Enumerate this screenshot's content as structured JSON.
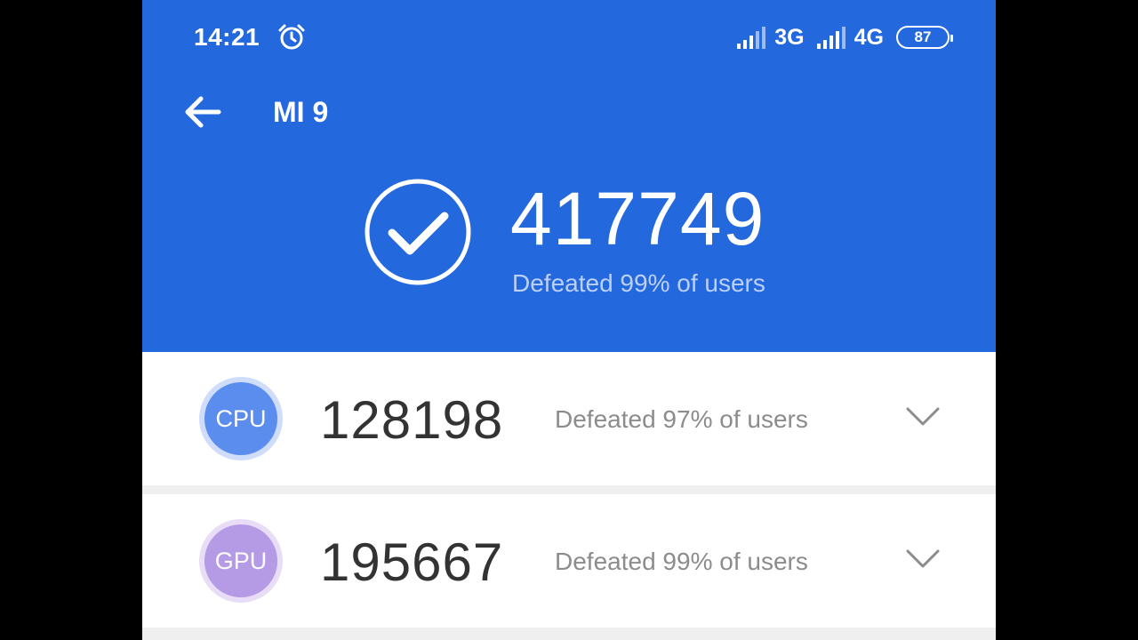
{
  "colors": {
    "header_blue": "#2468de",
    "cpu_badge": "#5b8def",
    "cpu_ring": "#cfdcfa",
    "gpu_badge": "#b59ae6",
    "gpu_ring": "#e8dcf7"
  },
  "status_bar": {
    "time": "14:21",
    "alarm_icon": "alarm-clock-icon",
    "network_1": "3G",
    "network_2": "4G",
    "battery_level": "87"
  },
  "header": {
    "title": "MI 9",
    "back_icon": "arrow-left-icon"
  },
  "total": {
    "score": "417749",
    "defeated_text": "Defeated 99% of users"
  },
  "cards": [
    {
      "label": "CPU",
      "score": "128198",
      "defeated_text": "Defeated 97% of users"
    },
    {
      "label": "GPU",
      "score": "195667",
      "defeated_text": "Defeated 99% of users"
    }
  ]
}
